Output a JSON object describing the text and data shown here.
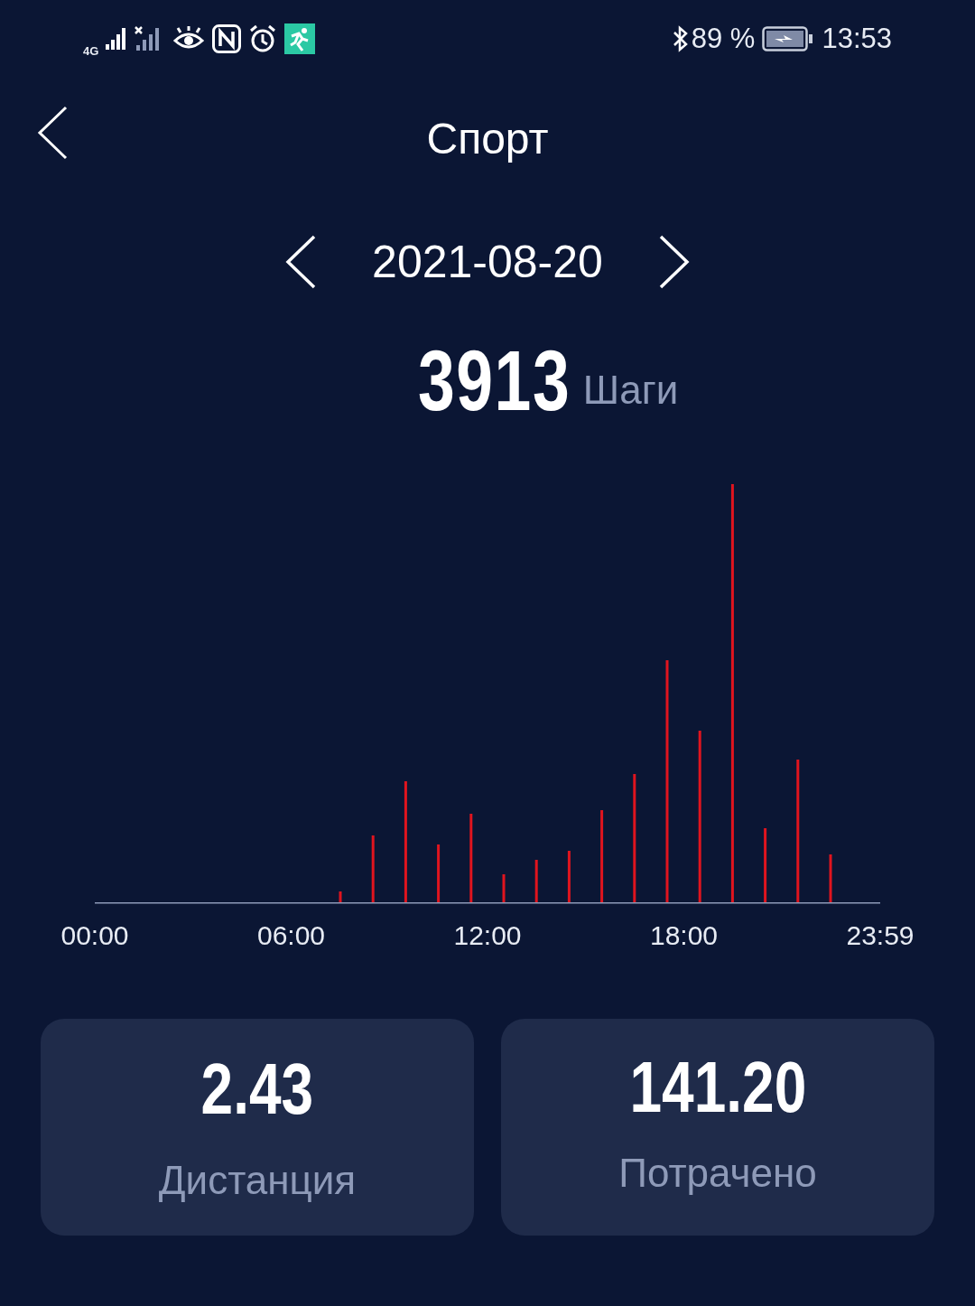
{
  "status_bar": {
    "network": "4G",
    "battery_percent": "89 %",
    "time": "13:53"
  },
  "header": {
    "title": "Спорт"
  },
  "date_nav": {
    "date": "2021-08-20"
  },
  "steps": {
    "value": "3913",
    "unit": "Шаги"
  },
  "chart": {
    "time_labels": [
      "00:00",
      "06:00",
      "12:00",
      "18:00",
      "23:59"
    ]
  },
  "stats": [
    {
      "value": "2.43",
      "label": "Дистанция"
    },
    {
      "value": "141.20",
      "label": "Потрачено"
    }
  ]
}
